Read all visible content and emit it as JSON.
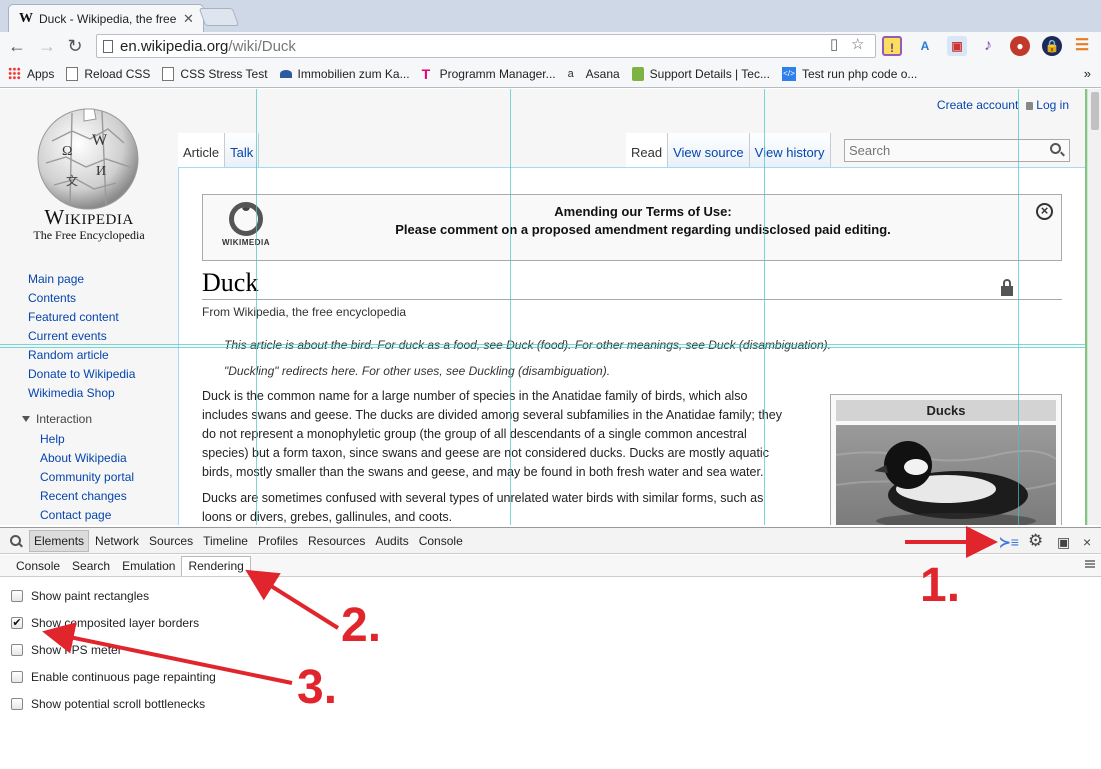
{
  "browser": {
    "tab_title": "Duck - Wikipedia, the free",
    "tab_favicon": "W",
    "url_host": "en.wikipedia.org",
    "url_path": "/wiki/Duck"
  },
  "bookmarks": [
    "Apps",
    "Reload CSS",
    "CSS Stress Test",
    "Immobilien zum Ka...",
    "Programm Manager...",
    "Asana",
    "Support Details | Tec...",
    "Test run php code o..."
  ],
  "bookmarks_more": "»",
  "wiki": {
    "wordmark": "Wikipedia",
    "tagline": "The Free Encyclopedia",
    "personal": {
      "create_account": "Create account",
      "login": "Log in"
    },
    "tabs_left": [
      "Article",
      "Talk"
    ],
    "tabs_right": [
      "Read",
      "View source",
      "View history"
    ],
    "search_placeholder": "Search",
    "nav_main": [
      "Main page",
      "Contents",
      "Featured content",
      "Current events",
      "Random article",
      "Donate to Wikipedia",
      "Wikimedia Shop"
    ],
    "nav_interaction_head": "Interaction",
    "nav_interaction": [
      "Help",
      "About Wikipedia",
      "Community portal",
      "Recent changes",
      "Contact page"
    ],
    "notice": {
      "logo_text": "WIKIMEDIA",
      "line1": "Amending our Terms of Use:",
      "line2": "Please comment on a proposed amendment regarding undisclosed paid editing."
    },
    "title": "Duck",
    "site_sub": "From Wikipedia, the free encyclopedia",
    "hatnote1": "This article is about the bird. For duck as a food, see Duck (food). For other meanings, see Duck (disambiguation).",
    "hatnote2": "\"Duckling\" redirects here. For other uses, see Duckling (disambiguation).",
    "para1": {
      "lines": [
        "Duck is the common name for a large number of species in the Anatidae family of birds, which also",
        "includes swans and geese. The ducks are divided among several subfamilies in the Anatidae family; they",
        "do not represent a monophyletic group (the group of all descendants of a single common ancestral",
        "species) but a form taxon, since swans and geese are not considered ducks. Ducks are mostly aquatic",
        "birds, mostly smaller than the swans and geese, and may be found in both fresh water and sea water."
      ]
    },
    "para2": {
      "lines": [
        "Ducks are sometimes confused with several types of unrelated water birds with similar forms, such as",
        "loons or divers, grebes, gallinules, and coots."
      ]
    },
    "infobox_caption": "Ducks"
  },
  "devtools": {
    "main_tabs": [
      "Elements",
      "Network",
      "Sources",
      "Timeline",
      "Profiles",
      "Resources",
      "Audits",
      "Console"
    ],
    "selected_main": "Elements",
    "sub_tabs": [
      "Console",
      "Search",
      "Emulation",
      "Rendering"
    ],
    "selected_sub": "Rendering",
    "options": [
      {
        "label": "Show paint rectangles",
        "checked": false
      },
      {
        "label": "Show composited layer borders",
        "checked": true
      },
      {
        "label": "Show FPS meter",
        "checked": false
      },
      {
        "label": "Enable continuous page repainting",
        "checked": false
      },
      {
        "label": "Show potential scroll bottlenecks",
        "checked": false
      }
    ],
    "close_label": "×"
  },
  "annotations": [
    "1.",
    "2.",
    "3."
  ],
  "colors": {
    "annotation_red": "#e0262c",
    "link": "#0645ad",
    "layer_border": "#40c8c8"
  }
}
